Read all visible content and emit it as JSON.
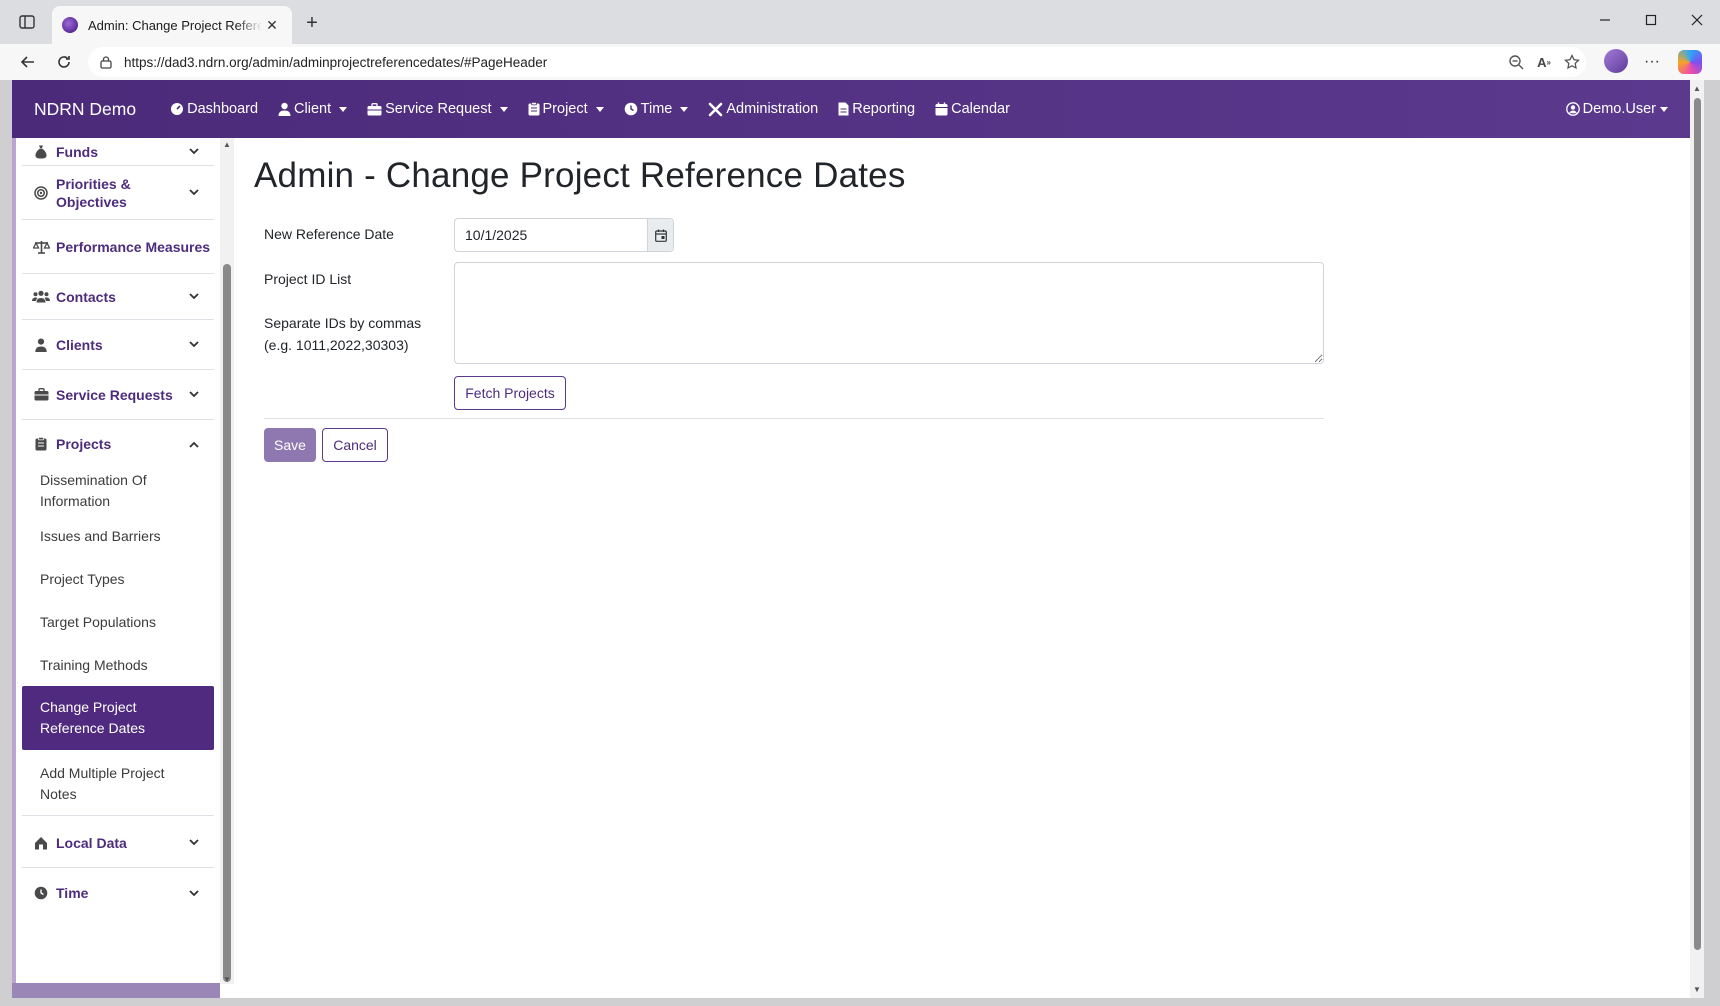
{
  "browser": {
    "tab_title": "Admin: Change Project Reference Dates",
    "url": "https://dad3.ndrn.org/admin/adminprojectreferencedates/#PageHeader"
  },
  "navbar": {
    "brand": "NDRN Demo",
    "items": [
      {
        "label": "Dashboard",
        "icon": "dashboard-icon",
        "dropdown": false
      },
      {
        "label": "Client",
        "icon": "user-icon",
        "dropdown": true
      },
      {
        "label": "Service Request",
        "icon": "briefcase-icon",
        "dropdown": true
      },
      {
        "label": "Project",
        "icon": "clipboard-icon",
        "dropdown": true
      },
      {
        "label": "Time",
        "icon": "clock-icon",
        "dropdown": true
      },
      {
        "label": "Administration",
        "icon": "tools-icon",
        "dropdown": false
      },
      {
        "label": "Reporting",
        "icon": "file-icon",
        "dropdown": false
      },
      {
        "label": "Calendar",
        "icon": "calendar-icon",
        "dropdown": false
      }
    ],
    "user": "Demo.User"
  },
  "sidebar": {
    "sections": [
      {
        "label": "Funds",
        "icon": "money-bag-icon",
        "expanded": false
      },
      {
        "label": "Priorities & Objectives",
        "icon": "target-icon",
        "expanded": false
      },
      {
        "label": "Performance Measures",
        "icon": "balance-scale-icon",
        "expanded": false
      },
      {
        "label": "Contacts",
        "icon": "users-icon",
        "expanded": false
      },
      {
        "label": "Clients",
        "icon": "user-icon",
        "expanded": false
      },
      {
        "label": "Service Requests",
        "icon": "briefcase-icon",
        "expanded": false
      },
      {
        "label": "Projects",
        "icon": "clipboard-icon",
        "expanded": true
      },
      {
        "label": "Local Data",
        "icon": "house-icon",
        "expanded": false
      },
      {
        "label": "Time",
        "icon": "clock-icon",
        "expanded": false
      }
    ],
    "project_items": [
      {
        "label": "Dissemination Of Information",
        "active": false
      },
      {
        "label": "Issues and Barriers",
        "active": false
      },
      {
        "label": "Project Types",
        "active": false
      },
      {
        "label": "Target Populations",
        "active": false
      },
      {
        "label": "Training Methods",
        "active": false
      },
      {
        "label": "Change Project Reference Dates",
        "active": true
      },
      {
        "label": "Add Multiple Project Notes",
        "active": false
      }
    ]
  },
  "main": {
    "title": "Admin - Change Project Reference Dates",
    "new_reference_date_label": "New Reference Date",
    "new_reference_date_value": "10/1/2025",
    "project_id_list_label": "Project ID List",
    "project_id_help_line1": "Separate IDs by commas",
    "project_id_help_line2": "(e.g. 1011,2022,30303)",
    "project_id_list_value": "",
    "fetch_button": "Fetch Projects",
    "save_button": "Save",
    "cancel_button": "Cancel"
  },
  "colors": {
    "navbar": "#4c2a7a",
    "accent": "#4f2a7f",
    "save_button": "#8f78b0"
  }
}
